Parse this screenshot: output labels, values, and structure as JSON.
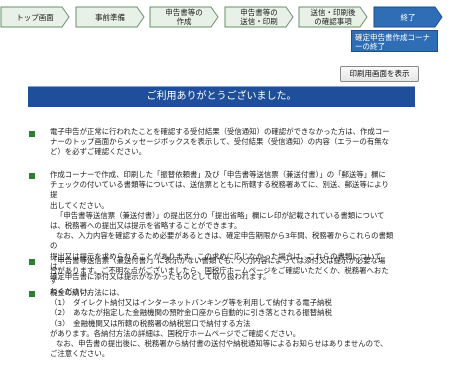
{
  "steps": [
    {
      "label": "トップ画面"
    },
    {
      "label": "事前準備"
    },
    {
      "label": "申告書等の\n作成"
    },
    {
      "label": "申告書等の\n送信・印刷"
    },
    {
      "label": "送信・印刷後\nの確認事項"
    },
    {
      "label": "終了"
    }
  ],
  "done_note": "確定申告書作成コーナーの終了",
  "print_button": "印刷用画面を表示",
  "banner": "ご利用ありがとうございました。",
  "paragraphs": [
    [
      "電子申告が正常に行われたことを確認する受付結果（受信通知）の確認ができなかった方は、作成コー",
      "ナーのトップ画面からメッセージボックスを表示して、受付結果（受信通知）の内容（エラーの有無な",
      "ど）を必ずご確認ください。"
    ],
    [
      "作成コーナーで作成、印刷した「振替依頼書」及び「申告書等送信票（兼送付書）」の「郵送等」欄に",
      "チェックの付いている書類等については、送信票とともに所轄する税務署あてに、別送、郵送等により提",
      "出してください。",
      "「申告書等送信票（兼送付書）」の提出区分の「提出省略」欄にレ印が記載されている書類について",
      "は、税務署への提出又は提示を省略することができます。",
      "なお、入力内容を確認するため必要があるときは、確定申告期限から3年間、税務署からこれらの書類の",
      "提出又は提示を求められることがあります。この求めに応じなかった場合は、これらの書類については、",
      "確定申告書に添付又は提示がなかったものとして取り扱われます。"
    ],
    [
      "「申告書等送信票（兼送付書）」に表示がない書類でも、入力内容によっては添付又は提示が必要な場",
      "合があります。ご不明な点がございましたら、国税庁ホームページをご確認いただくか、税務署へおたず",
      "ねください。"
    ],
    [
      "税金の納付方法には、",
      "（1）　ダイレクト納付又はインターネットバンキング等を利用して納付する電子納税",
      "（2）　あなたが指定した金融機関の預貯金口座から自動的に引き落とされる振替納税",
      "（3）　金融機関又は所轄の税務署の納税窓口で納付する方法",
      "があります。各納付方法の詳細は、国税庁ホームページでご確認ください。",
      "なお、申告書の提出後に、税務署から納付書の送付や納税通知等によるお知らせはありませんので、",
      "ご注意ください。"
    ]
  ],
  "colors": {
    "step_bg": "#e7f1e7",
    "step_active": "#2f6db5",
    "banner": "#1f4e9a",
    "bullet": "#2e7d32"
  }
}
